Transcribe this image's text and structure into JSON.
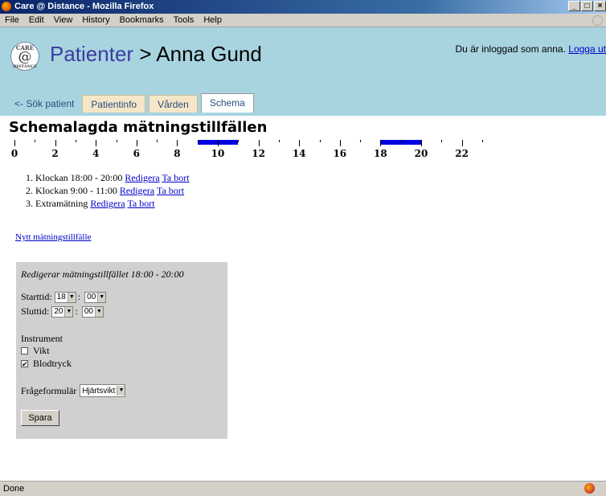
{
  "window": {
    "title": "Care @ Distance - Mozilla Firefox",
    "buttons": {
      "minimize": "_",
      "maximize": "□",
      "close": "×"
    }
  },
  "menu": [
    "File",
    "Edit",
    "View",
    "History",
    "Bookmarks",
    "Tools",
    "Help"
  ],
  "header": {
    "logo": {
      "top": "CARE",
      "middle": "@",
      "bottom": "DISTANCE"
    },
    "breadcrumb": "Patienter",
    "separator": ">",
    "patient": "Anna Gund",
    "login_text": "Du är inloggad som anna.",
    "logout_link": "Logga ut"
  },
  "tabs": {
    "back": "<- Sök patient",
    "items": [
      "Patientinfo",
      "Vården",
      "Schema"
    ],
    "active": "Schema"
  },
  "page_title": "Schemalagda mätningstillfällen",
  "timeline": {
    "labels": [
      "0",
      "2",
      "4",
      "6",
      "8",
      "10",
      "12",
      "14",
      "16",
      "18",
      "20",
      "22"
    ],
    "scheduled": [
      {
        "start": 9,
        "end": 11
      },
      {
        "start": 18,
        "end": 20
      }
    ],
    "color": "#0000e0"
  },
  "schedule": [
    {
      "text": "Klockan 18:00 - 20:00",
      "edit": "Redigera",
      "remove": "Ta bort"
    },
    {
      "text": "Klockan 9:00 - 11:00",
      "edit": "Redigera",
      "remove": "Ta bort"
    },
    {
      "text": "Extramätning",
      "edit": "Redigera",
      "remove": "Ta bort"
    }
  ],
  "new_link": "Nytt mätningstillfälle",
  "edit_form": {
    "title": "Redigerar mätningstillfället 18:00 - 20:00",
    "start_label": "Starttid:",
    "start_hour": "18",
    "start_minute": "00",
    "end_label": "Sluttid:",
    "end_hour": "20",
    "end_minute": "00",
    "time_separator": ":",
    "instrument_label": "Instrument",
    "instruments": [
      {
        "label": "Vikt",
        "checked": false
      },
      {
        "label": "Blodtryck",
        "checked": true
      }
    ],
    "form_label": "Frågeformulär",
    "form_value": "Hjärtsvikt",
    "save_label": "Spara"
  },
  "status": "Done"
}
